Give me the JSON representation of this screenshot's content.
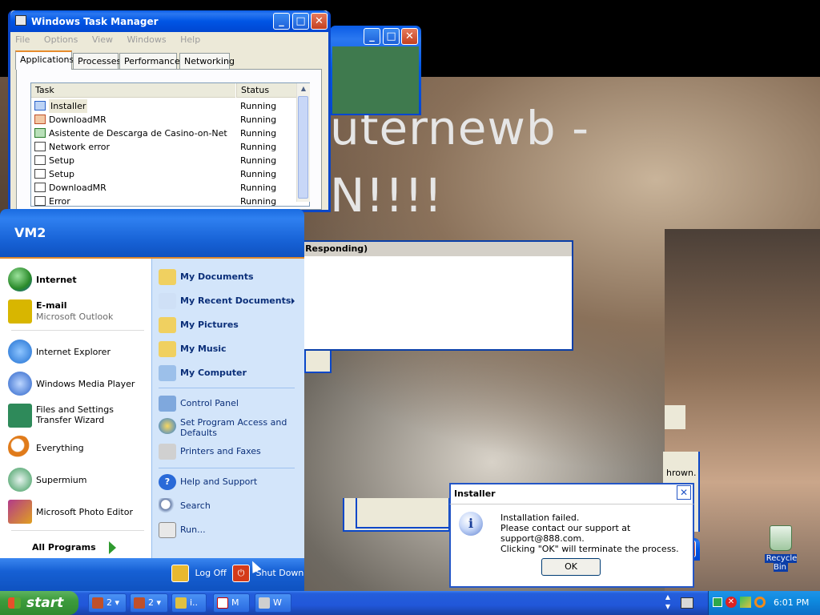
{
  "desktop": {
    "overlay_line1": "uternewb -",
    "overlay_line2": "N!!!!",
    "recycle_bin_label": "Recycle Bin"
  },
  "not_responding_window": {
    "title_fragment": "t Responding)"
  },
  "stacked_dialog": {
    "text_fragment": "hrown."
  },
  "task_manager": {
    "title": "Windows Task Manager",
    "menu": [
      "File",
      "Options",
      "View",
      "Windows",
      "Help"
    ],
    "tabs": [
      "Applications",
      "Processes",
      "Performance",
      "Networking"
    ],
    "active_tab": "Applications",
    "columns": [
      "Task",
      "Status"
    ],
    "rows": [
      {
        "task": "Installer",
        "status": "Running"
      },
      {
        "task": "DownloadMR",
        "status": "Running"
      },
      {
        "task": "Asistente de Descarga de Casino-on-Net",
        "status": "Running"
      },
      {
        "task": "Network error",
        "status": "Running"
      },
      {
        "task": "Setup",
        "status": "Running"
      },
      {
        "task": "Setup",
        "status": "Running"
      },
      {
        "task": "DownloadMR",
        "status": "Running"
      },
      {
        "task": "Error",
        "status": "Running"
      }
    ]
  },
  "start_menu": {
    "user": "VM2",
    "pinned": [
      {
        "title": "Internet",
        "subtitle": "",
        "icon": "globe-icon",
        "color": "#2a8a2a"
      },
      {
        "title": "E-mail",
        "subtitle": "Microsoft Outlook",
        "icon": "outlook-icon",
        "color": "#d8b600"
      }
    ],
    "recent": [
      {
        "title": "Internet Explorer",
        "icon": "ie-icon",
        "color": "#1f6fd1"
      },
      {
        "title": "Windows Media Player",
        "icon": "media-player-icon",
        "color": "#2a62c9"
      },
      {
        "title": "Files and Settings Transfer Wizard",
        "icon": "transfer-wizard-icon",
        "color": "#2e8a5a"
      },
      {
        "title": "Everything",
        "icon": "magnifier-icon",
        "color": "#e07b1a"
      },
      {
        "title": "Supermium",
        "icon": "supermium-icon",
        "color": "#3b9a5b"
      },
      {
        "title": "Microsoft Photo Editor",
        "icon": "photo-editor-icon",
        "color": "#b23a8a"
      }
    ],
    "all_programs": "All Programs",
    "right": [
      {
        "title": "My Documents",
        "bold": true
      },
      {
        "title": "My Recent Documents",
        "bold": true
      },
      {
        "title": "My Pictures",
        "bold": true
      },
      {
        "title": "My Music",
        "bold": true
      },
      {
        "title": "My Computer",
        "bold": true
      },
      {
        "title": "Control Panel",
        "bold": false
      },
      {
        "title": "Set Program Access and Defaults",
        "bold": false
      },
      {
        "title": "Printers and Faxes",
        "bold": false
      },
      {
        "title": "Help and Support",
        "bold": false
      },
      {
        "title": "Search",
        "bold": false
      },
      {
        "title": "Run...",
        "bold": false
      }
    ],
    "log_off": "Log Off",
    "shut_down": "Shut Down"
  },
  "installer_dialog": {
    "title": "Installer",
    "line1": "Installation failed.",
    "line2": "Please contact our support at support@888.com.",
    "line3": "Clicking \"OK\" will terminate the process.",
    "ok": "OK"
  },
  "taskbar": {
    "start": "start",
    "buttons": [
      {
        "label": "2",
        "color": "#c0502a"
      },
      {
        "label": "2",
        "color": "#c0502a"
      },
      {
        "label": "i..",
        "color": "#e0c040"
      },
      {
        "label": "M",
        "color": "#ffffff"
      },
      {
        "label": "W",
        "color": "#cfcfcf"
      }
    ],
    "clock": "6:01 PM"
  }
}
